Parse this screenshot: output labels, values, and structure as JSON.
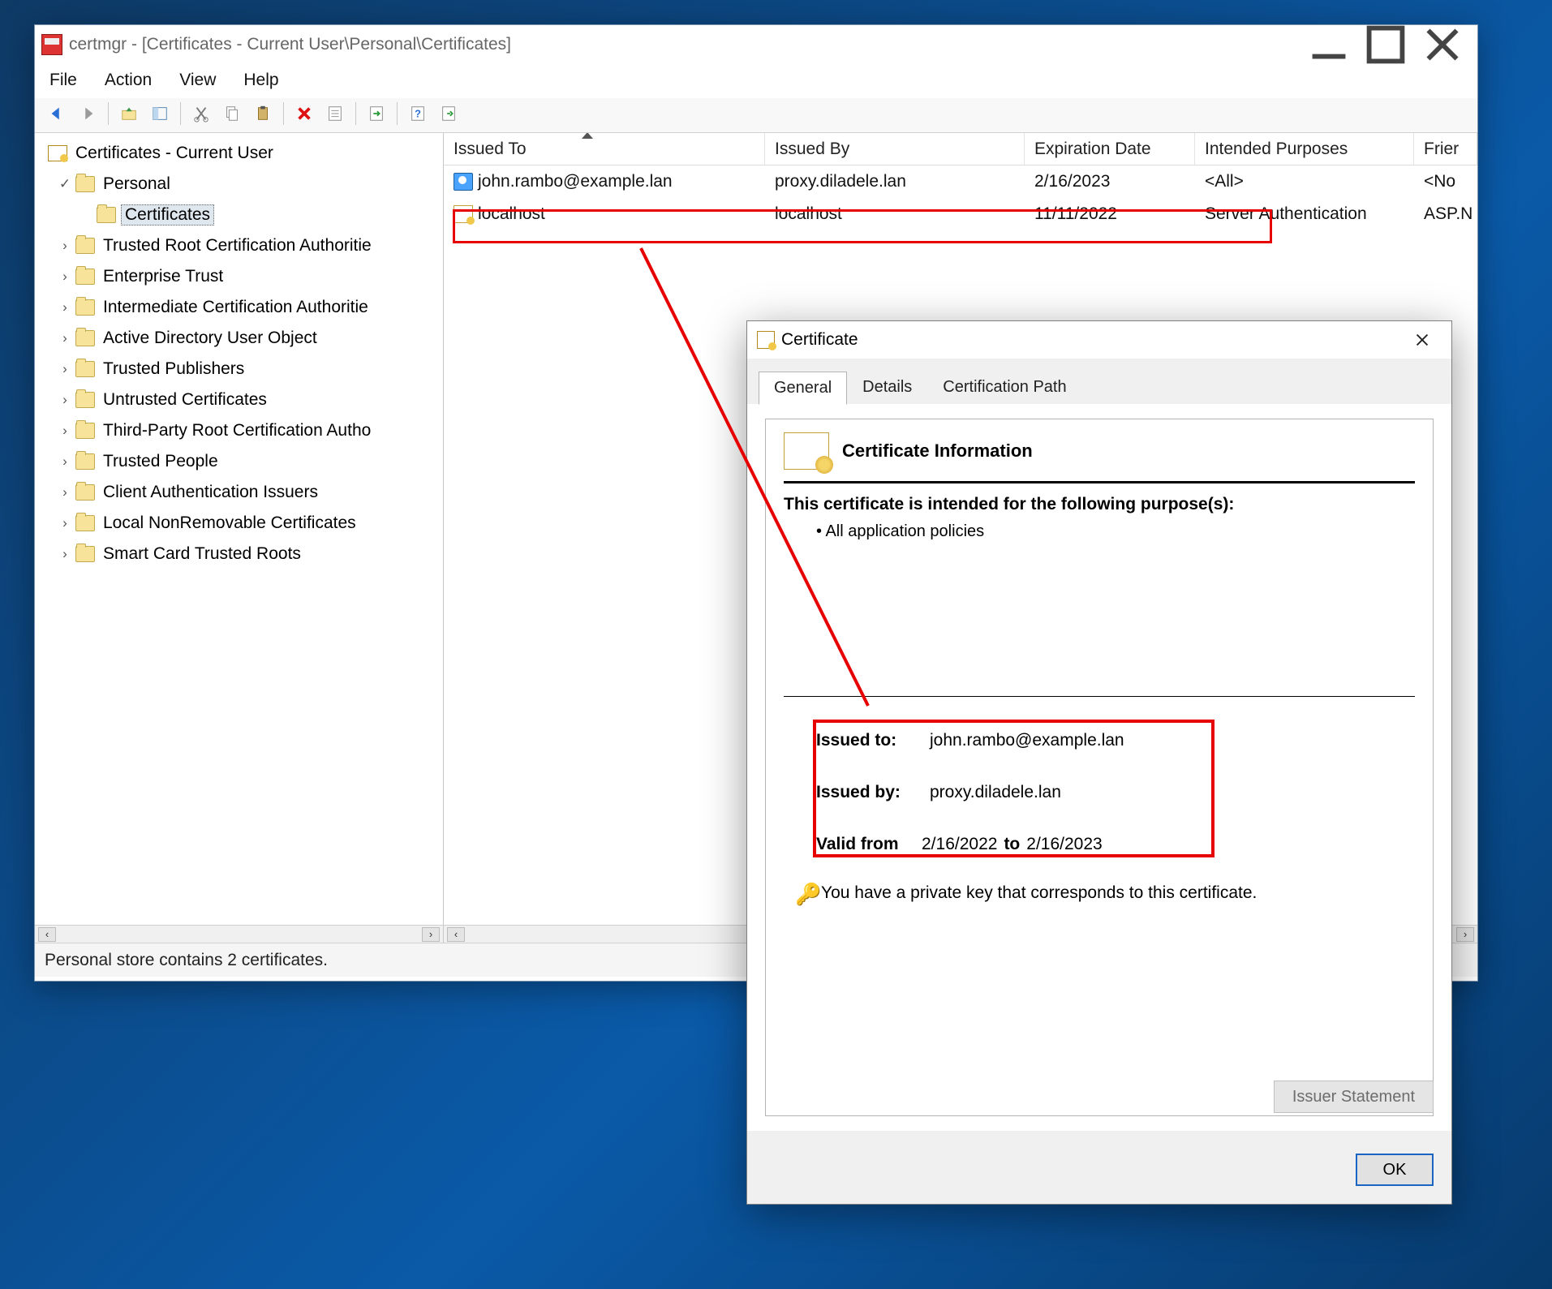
{
  "mmc": {
    "title": "certmgr - [Certificates - Current User\\Personal\\Certificates]",
    "menus": [
      "File",
      "Action",
      "View",
      "Help"
    ],
    "status": "Personal store contains 2 certificates."
  },
  "tree": {
    "root": "Certificates - Current User",
    "personal": "Personal",
    "certificates": "Certificates",
    "items": [
      "Trusted Root Certification Authoritie",
      "Enterprise Trust",
      "Intermediate Certification Authoritie",
      "Active Directory User Object",
      "Trusted Publishers",
      "Untrusted Certificates",
      "Third-Party Root Certification Autho",
      "Trusted People",
      "Client Authentication Issuers",
      "Local NonRemovable Certificates",
      "Smart Card Trusted Roots"
    ]
  },
  "list": {
    "columns": {
      "issued_to": "Issued To",
      "issued_by": "Issued By",
      "expiration": "Expiration Date",
      "purposes": "Intended Purposes",
      "friendly": "Frier"
    },
    "rows": [
      {
        "issued_to": "john.rambo@example.lan",
        "issued_by": "proxy.diladele.lan",
        "expiration": "2/16/2023",
        "purposes": "<All>",
        "friendly": "<No"
      },
      {
        "issued_to": "localhost",
        "issued_by": "localhost",
        "expiration": "11/11/2022",
        "purposes": "Server Authentication",
        "friendly": "ASP.N"
      }
    ]
  },
  "dialog": {
    "title": "Certificate",
    "tabs": {
      "general": "General",
      "details": "Details",
      "certpath": "Certification Path"
    },
    "header": "Certificate Information",
    "purpose_intro": "This certificate is intended for the following purpose(s):",
    "purpose_item": "All application policies",
    "issued_to_label": "Issued to:",
    "issued_to_value": "john.rambo@example.lan",
    "issued_by_label": "Issued by:",
    "issued_by_value": "proxy.diladele.lan",
    "valid_from_label": "Valid from",
    "valid_from_value": "2/16/2022",
    "valid_to_label": "to",
    "valid_to_value": "2/16/2023",
    "key_note": "You have a private key that corresponds to this certificate.",
    "issuer_btn": "Issuer Statement",
    "ok_btn": "OK"
  }
}
